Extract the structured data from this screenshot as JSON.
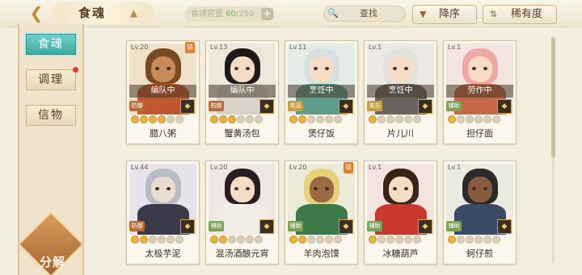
{
  "header": {
    "back_icon": "back-arrow-icon",
    "title": "食魂",
    "capacity_label": "食魂容量",
    "capacity_current": "60",
    "capacity_sep_max": "/250",
    "plus": "+",
    "search_placeholder": "查找",
    "sort_label": "降序",
    "filter_label": "稀有度"
  },
  "sidebar": {
    "tabs": [
      "食魂",
      "调理",
      "信物"
    ],
    "decompose": "分解"
  },
  "cards": [
    {
      "level": "Lv.20",
      "name": "腊八粥",
      "status": "编队中",
      "role": "防御",
      "stars": 4,
      "fav": "锁"
    },
    {
      "level": "Lv.13",
      "name": "蟹黄汤包",
      "status": "编队中",
      "role": "防御",
      "stars": 3,
      "fav": ""
    },
    {
      "level": "Lv.11",
      "name": "煲仔饭",
      "status": "烹饪中",
      "role": "攻击",
      "stars": 2,
      "fav": ""
    },
    {
      "level": "Lv.1",
      "name": "片儿川",
      "status": "烹饪中",
      "role": "攻击",
      "stars": 1,
      "fav": ""
    },
    {
      "level": "Lv.1",
      "name": "担仔面",
      "status": "劳作中",
      "role": "辅助",
      "stars": 1,
      "fav": ""
    },
    {
      "level": "Lv.44",
      "name": "太极芋泥",
      "status": "",
      "role": "防御",
      "stars": 2,
      "fav": ""
    },
    {
      "level": "Lv.20",
      "name": "混汤酒酿元宵",
      "status": "",
      "role": "辅助",
      "stars": 2,
      "fav": ""
    },
    {
      "level": "Lv.20",
      "name": "羊肉泡馍",
      "status": "",
      "role": "辅助",
      "stars": 2,
      "fav": "锁"
    },
    {
      "level": "Lv.1",
      "name": "冰糖葫芦",
      "status": "",
      "role": "辅助",
      "stars": 1,
      "fav": ""
    },
    {
      "level": "Lv.1",
      "name": "蚵仔煎",
      "status": "",
      "role": "辅助",
      "stars": 1,
      "fav": ""
    }
  ],
  "colors": {
    "accent_teal": "#3fa9a3",
    "gold": "#e9b440",
    "background": "#f4eee0"
  }
}
